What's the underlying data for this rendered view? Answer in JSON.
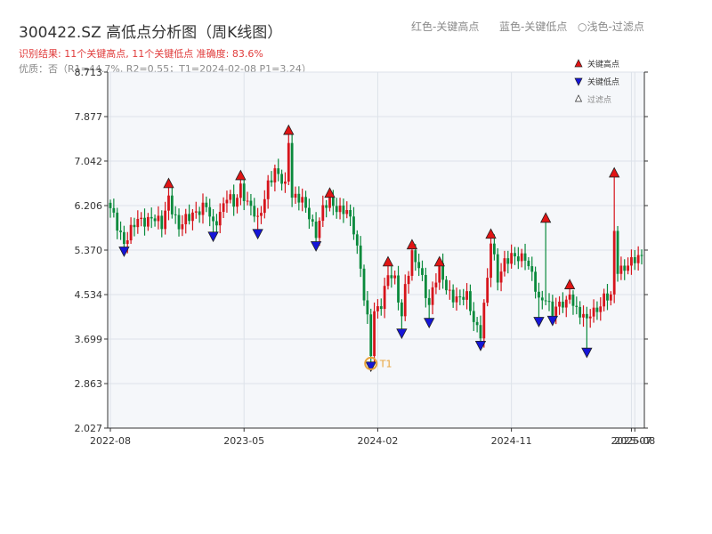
{
  "header": {
    "title": "300422.SZ 高低点分析图（周K线图）",
    "legend_red": "红色-关键高点",
    "legend_blue": "蓝色-关键低点",
    "legend_light": "浅色-过滤点",
    "result_line": "识别结果: 11个关键高点, 11个关键低点  准确度: 83.6%",
    "quality_line": "优质：否（R1=44.7%, R2=0.55；T1=2024-02-08 P1=3.24）"
  },
  "colors": {
    "up": "#d6141b",
    "down": "#0a8a3c",
    "high_marker": "#e11414",
    "low_marker": "#1515d8",
    "t1_ring": "#e8a33a",
    "grid": "#dde2e9",
    "plot_bg": "#f5f7fa"
  },
  "chart_data": {
    "type": "candlestick",
    "y_ticks": [
      "2.027",
      "2.863",
      "3.699",
      "4.534",
      "5.370",
      "6.206",
      "7.042",
      "7.877",
      "8.713"
    ],
    "ylim": [
      2.027,
      8.713
    ],
    "x_ticks": [
      "2022-08",
      "2023-05",
      "2024-02",
      "2024-11",
      "2025-07",
      "2025-08"
    ],
    "x_tick_pos": [
      0,
      39,
      78,
      117,
      152,
      153
    ],
    "x_count": 156,
    "legend": {
      "high": "关键高点",
      "low": "关键低点",
      "filtered": "过滤点"
    },
    "t1": {
      "label": "T1",
      "date": "2024-02-08",
      "price": 3.24,
      "x_index": 76
    },
    "key_highs": [
      {
        "x": 17,
        "price": 6.55
      },
      {
        "x": 38,
        "price": 6.7
      },
      {
        "x": 52,
        "price": 7.55
      },
      {
        "x": 64,
        "price": 6.37
      },
      {
        "x": 81,
        "price": 5.08
      },
      {
        "x": 88,
        "price": 5.4
      },
      {
        "x": 96,
        "price": 5.08
      },
      {
        "x": 111,
        "price": 5.6
      },
      {
        "x": 127,
        "price": 5.9
      },
      {
        "x": 134,
        "price": 4.65
      },
      {
        "x": 147,
        "price": 6.75
      }
    ],
    "key_lows": [
      {
        "x": 4,
        "price": 5.42
      },
      {
        "x": 30,
        "price": 5.7
      },
      {
        "x": 43,
        "price": 5.75
      },
      {
        "x": 60,
        "price": 5.52
      },
      {
        "x": 76,
        "price": 3.26
      },
      {
        "x": 85,
        "price": 3.88
      },
      {
        "x": 93,
        "price": 4.08
      },
      {
        "x": 108,
        "price": 3.65
      },
      {
        "x": 125,
        "price": 4.1
      },
      {
        "x": 129,
        "price": 4.12
      },
      {
        "x": 139,
        "price": 3.52
      }
    ],
    "close_anchors": [
      [
        0,
        6.1
      ],
      [
        4,
        5.55
      ],
      [
        8,
        5.9
      ],
      [
        12,
        6.0
      ],
      [
        15,
        5.8
      ],
      [
        17,
        6.4
      ],
      [
        20,
        5.75
      ],
      [
        24,
        6.1
      ],
      [
        28,
        6.15
      ],
      [
        30,
        5.85
      ],
      [
        34,
        6.35
      ],
      [
        36,
        6.2
      ],
      [
        38,
        6.6
      ],
      [
        40,
        6.25
      ],
      [
        43,
        5.9
      ],
      [
        46,
        6.65
      ],
      [
        48,
        6.8
      ],
      [
        51,
        6.6
      ],
      [
        52,
        7.5
      ],
      [
        53,
        6.4
      ],
      [
        56,
        6.25
      ],
      [
        58,
        6.05
      ],
      [
        60,
        5.7
      ],
      [
        62,
        6.1
      ],
      [
        64,
        6.3
      ],
      [
        66,
        6.2
      ],
      [
        69,
        6.05
      ],
      [
        71,
        5.75
      ],
      [
        73,
        5.1
      ],
      [
        74,
        4.5
      ],
      [
        75,
        4.05
      ],
      [
        76,
        3.4
      ],
      [
        77,
        4.15
      ],
      [
        79,
        4.4
      ],
      [
        81,
        4.95
      ],
      [
        83,
        4.75
      ],
      [
        85,
        4.1
      ],
      [
        86,
        4.75
      ],
      [
        88,
        5.3
      ],
      [
        90,
        5.0
      ],
      [
        93,
        4.35
      ],
      [
        94,
        4.7
      ],
      [
        96,
        5.0
      ],
      [
        98,
        4.6
      ],
      [
        101,
        4.5
      ],
      [
        104,
        4.45
      ],
      [
        106,
        4.05
      ],
      [
        108,
        3.85
      ],
      [
        110,
        4.8
      ],
      [
        111,
        5.5
      ],
      [
        113,
        4.85
      ],
      [
        115,
        5.2
      ],
      [
        117,
        5.2
      ],
      [
        119,
        5.2
      ],
      [
        121,
        5.3
      ],
      [
        123,
        4.9
      ],
      [
        125,
        4.35
      ],
      [
        127,
        4.5
      ],
      [
        129,
        4.25
      ],
      [
        131,
        4.3
      ],
      [
        133,
        4.35
      ],
      [
        134,
        4.6
      ],
      [
        136,
        4.25
      ],
      [
        139,
        4.0
      ],
      [
        140,
        4.2
      ],
      [
        142,
        4.3
      ],
      [
        144,
        4.45
      ],
      [
        146,
        4.45
      ],
      [
        147,
        5.7
      ],
      [
        148,
        5.05
      ],
      [
        150,
        5.05
      ],
      [
        152,
        5.1
      ],
      [
        155,
        5.3
      ]
    ]
  }
}
